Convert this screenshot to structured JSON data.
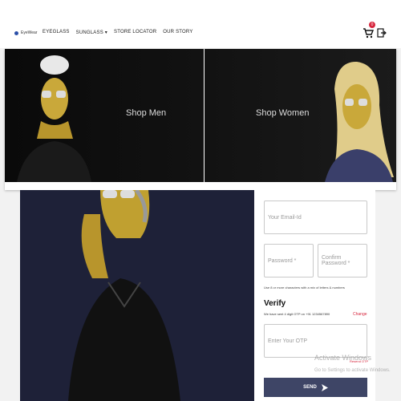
{
  "header": {
    "logo_text": "EyeWear",
    "nav": [
      "EYEGLASS",
      "SUNGLASS",
      "STORE LOCATOR",
      "OUR STORY"
    ],
    "cart_count": "0"
  },
  "mega_menu": {
    "men_label": "Shop Men",
    "women_label": "Shop Women"
  },
  "form": {
    "email_placeholder": "Your Email-Id",
    "password_placeholder": "Password *",
    "confirm_placeholder": "Confirm Password *",
    "password_hint": "Use 8 or more characters with a mix of letters & numbers",
    "verify_title": "Verify",
    "otp_sent_text": "We have sent 4 digit OTP on +91 1234567890",
    "change_link": "Change",
    "otp_placeholder": "Enter Your OTP",
    "resend_link": "Resend OTP",
    "send_label": "SEND"
  },
  "watermark": {
    "line1": "Activate Windows",
    "line2": "Go to Settings to activate Windows."
  }
}
